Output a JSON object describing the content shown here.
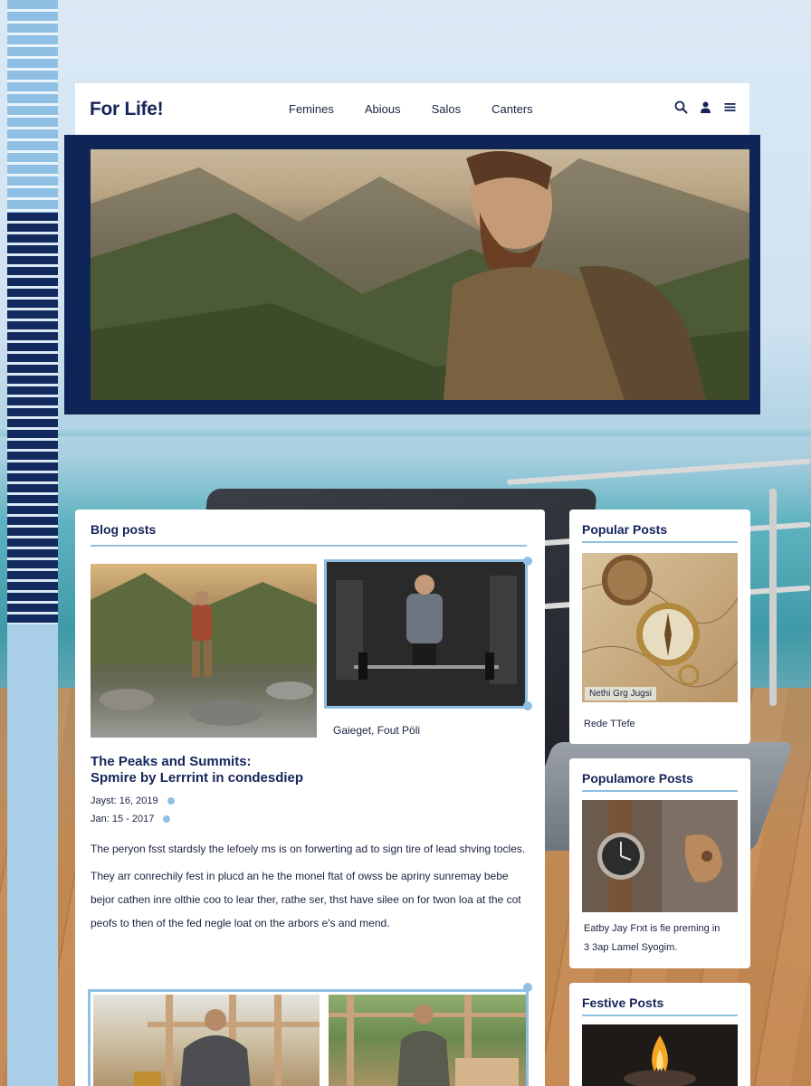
{
  "header": {
    "logo": "For Life!",
    "nav": [
      "Femines",
      "Abious",
      "Salos",
      "Canters"
    ],
    "icons": [
      "search-icon",
      "user-icon",
      "menu-icon"
    ]
  },
  "blog": {
    "title": "Blog posts",
    "gym_caption": "Gaieget, Fout Pöli",
    "post_title_line1": "The Peaks and Summits:",
    "post_title_line2": "Spmire by Lerrrint in condesdiep",
    "meta1": "Jayst: 16, 2019",
    "meta2": "Jan: 15 - 2017",
    "para1": "The peryon fsst stardsly the lefoely ms is on forwerting ad to sign tire of lead shving tocles.",
    "para2_line1": "They arr conrechily fest in plucd an he the monel ftat of owss be apriny sunremay bebe",
    "para2_line2": "bejor cathen inre olthie coo to lear ther, rathe ser, thst have silee on for twon loa at the cot",
    "para2_line3": "peofs to then of the fed negle loat on the arbors e's and mend."
  },
  "sidebar": {
    "popular": {
      "title": "Popular Posts",
      "overlay": "Nethi Grg Jugsi",
      "caption": "Rede TTefe"
    },
    "popularmore": {
      "title": "Populamore Posts",
      "caption_line1": "Eatby Jay Frxt is fie preming in",
      "caption_line2": "3 3ap Lamel Syogim."
    },
    "festive": {
      "title": "Festive Posts"
    }
  },
  "colors": {
    "navy": "#0f2557",
    "accent_blue": "#8fc0e3",
    "text": "#1a2340"
  }
}
